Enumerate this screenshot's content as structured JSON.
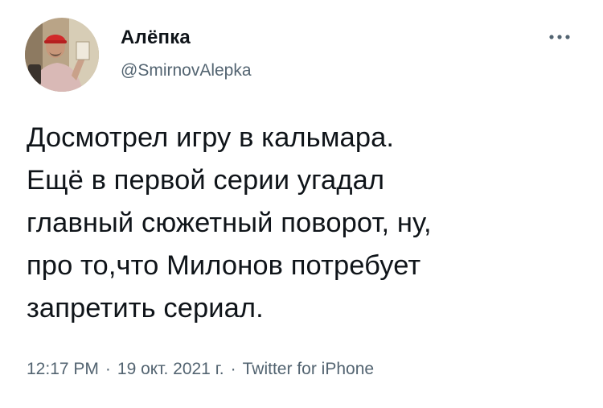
{
  "tweet": {
    "author": {
      "display_name": "Алёпка",
      "handle": "@SmirnovAlepka",
      "avatar": "user-avatar-photo"
    },
    "more_icon": "more-dots-icon",
    "text": "Досмотрел игру в кальмара.\nЕщё в первой серии угадал\nглавный сюжетный поворот, ну,\nпро то,что Милонов потребует\nзапретить сериал.",
    "meta": {
      "time": "12:17 PM",
      "date": "19 окт. 2021 г.",
      "source": "Twitter for iPhone",
      "separator": "·"
    }
  },
  "colors": {
    "text": "#0f1419",
    "secondary": "#536471",
    "background": "#ffffff"
  }
}
